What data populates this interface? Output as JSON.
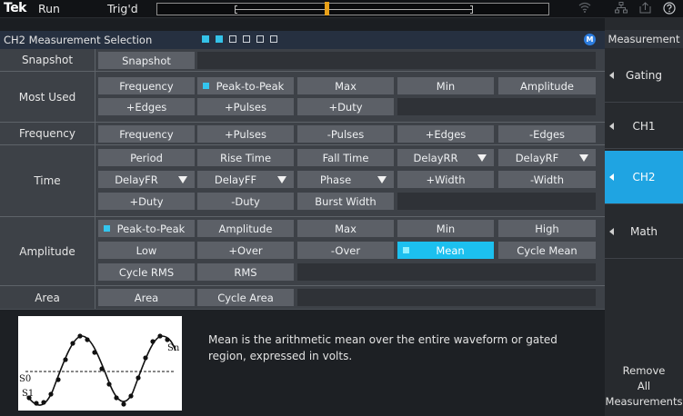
{
  "topbar": {
    "brand": "Tek",
    "state": "Run",
    "trigger_status": "Trig'd",
    "trigger_marker": "T"
  },
  "panel": {
    "title": "CH2 Measurement Selection",
    "page_dots": [
      true,
      true,
      false,
      false,
      false,
      false,
      false
    ],
    "badge": "M"
  },
  "rows": {
    "snapshot": "Snapshot",
    "most_used": "Most Used",
    "frequency": "Frequency",
    "time": "Time",
    "amplitude": "Amplitude",
    "area": "Area"
  },
  "cells": {
    "snapshot": "Snapshot",
    "mu_frequency": "Frequency",
    "mu_peak_to_peak": "Peak-to-Peak",
    "mu_max": "Max",
    "mu_min": "Min",
    "mu_amplitude": "Amplitude",
    "mu_pos_edges": "+Edges",
    "mu_pos_pulses": "+Pulses",
    "mu_pos_duty": "+Duty",
    "fr_frequency": "Frequency",
    "fr_pos_pulses": "+Pulses",
    "fr_neg_pulses": "-Pulses",
    "fr_pos_edges": "+Edges",
    "fr_neg_edges": "-Edges",
    "t_period": "Period",
    "t_rise_time": "Rise Time",
    "t_fall_time": "Fall Time",
    "t_delay_rr": "DelayRR",
    "t_delay_rf": "DelayRF",
    "t_delay_fr": "DelayFR",
    "t_delay_ff": "DelayFF",
    "t_phase": "Phase",
    "t_pos_width": "+Width",
    "t_neg_width": "-Width",
    "t_pos_duty": "+Duty",
    "t_neg_duty": "-Duty",
    "t_burst_width": "Burst Width",
    "a_peak_to_peak": "Peak-to-Peak",
    "a_amplitude": "Amplitude",
    "a_max": "Max",
    "a_min": "Min",
    "a_high": "High",
    "a_low": "Low",
    "a_pos_over": "+Over",
    "a_neg_over": "-Over",
    "a_mean": "Mean",
    "a_cycle_mean": "Cycle Mean",
    "a_cycle_rms": "Cycle RMS",
    "a_rms": "RMS",
    "ar_area": "Area",
    "ar_cycle_area": "Cycle Area"
  },
  "info": {
    "description": "Mean is the arithmetic mean over the entire waveform or gated region, expressed in volts.",
    "label_s0": "S0",
    "label_s1": "S1",
    "label_sn": "Sn"
  },
  "sidebar": {
    "title": "Measurement",
    "gating": "Gating",
    "ch1": "CH1",
    "ch2": "CH2",
    "math": "Math",
    "remove_line1": "Remove",
    "remove_line2": "All",
    "remove_line3": "Measurements"
  },
  "colors": {
    "accent": "#1cc0ef",
    "active_side": "#1fa4e2",
    "trigger": "#e8a019",
    "button": "#5c6067"
  },
  "icons": [
    "wifi-icon",
    "network-icon",
    "export-icon",
    "help-icon",
    "dropdown-triangle-icon"
  ]
}
